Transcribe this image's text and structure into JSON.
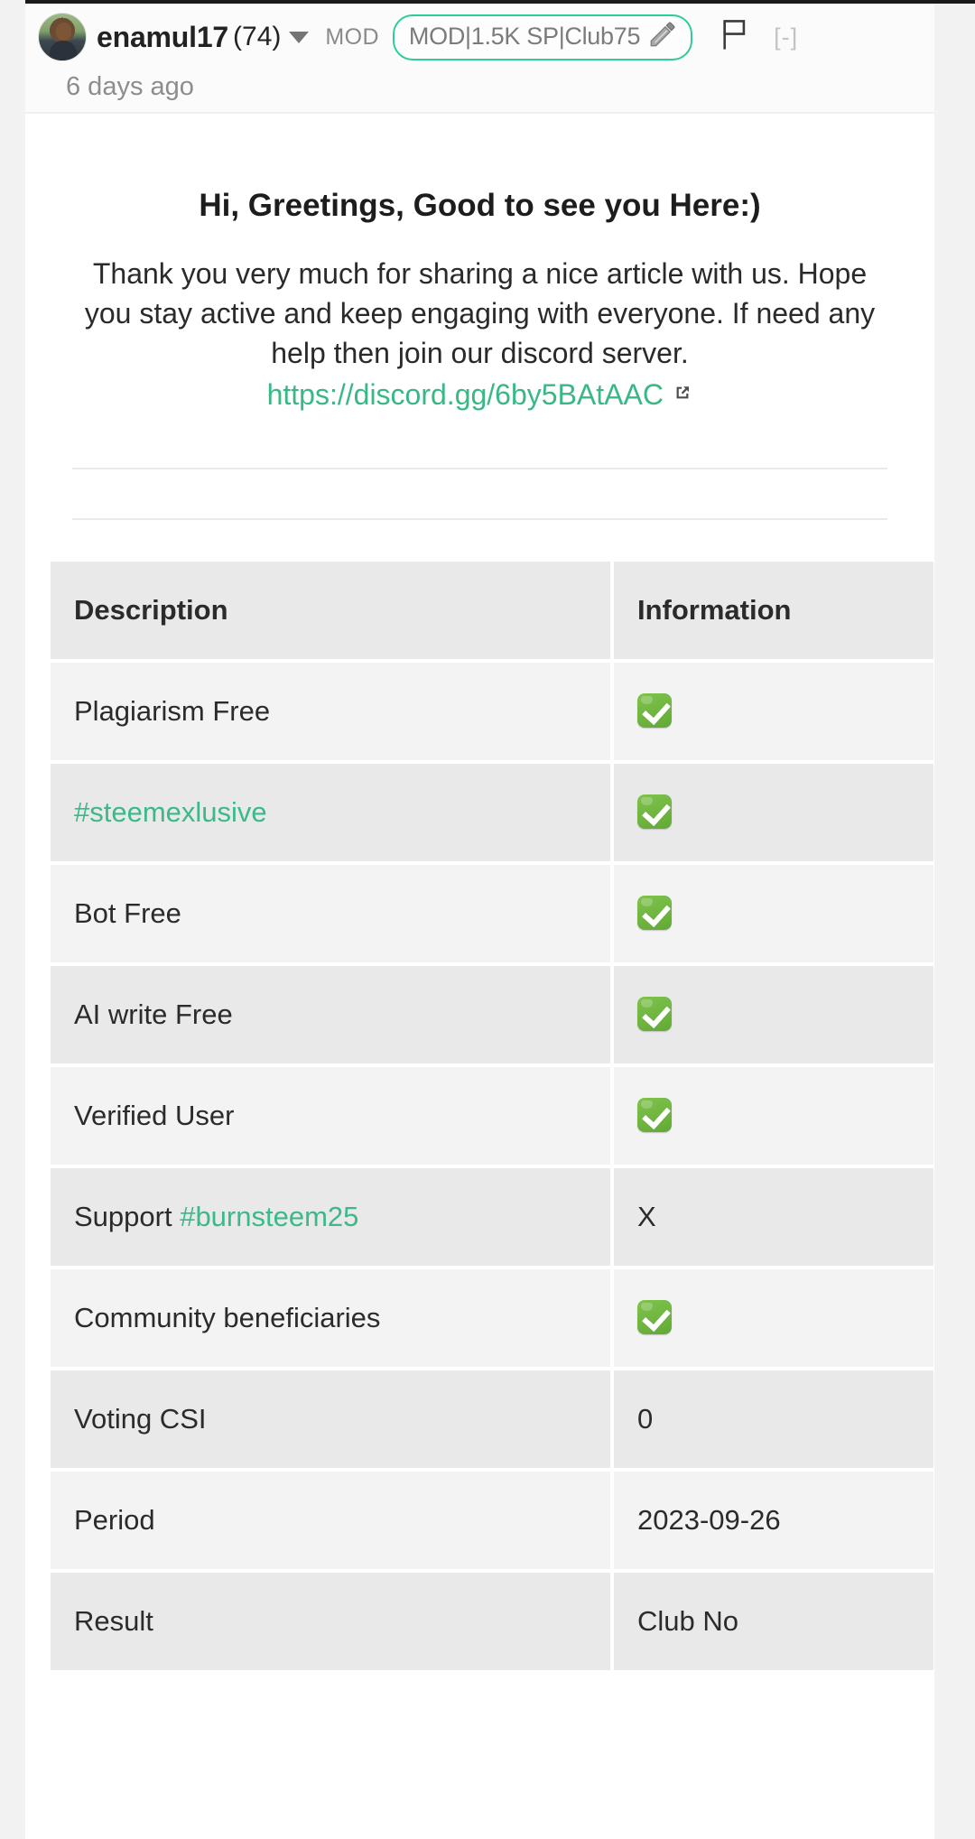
{
  "header": {
    "author": "enamul17",
    "reputation": "(74)",
    "mod_label": "MOD",
    "badge_text": "MOD|1.5K SP|Club75",
    "pencil_icon": "pencil-icon",
    "flag_icon": "flag-icon",
    "collapse_label": "[-]",
    "timestamp": "6 days ago",
    "caret_icon": "chevron-down-icon",
    "avatar_alt": "avatar"
  },
  "body": {
    "greeting": "Hi, Greetings, Good to see you Here:)",
    "paragraph": "Thank you very much for sharing a nice article with us. Hope you stay active and keep engaging with everyone. If need any help then join our discord server.",
    "discord_url": "https://discord.gg/6by5BAtAAC",
    "external_link_icon": "external-link-icon"
  },
  "table": {
    "headers": [
      "Description",
      "Information"
    ],
    "rows": [
      {
        "description": "Plagiarism Free",
        "tag": "",
        "value": "",
        "value_type": "check"
      },
      {
        "description": "",
        "tag": "#steemexlusive",
        "value": "",
        "value_type": "check"
      },
      {
        "description": "Bot Free",
        "tag": "",
        "value": "",
        "value_type": "check"
      },
      {
        "description": "AI write Free",
        "tag": "",
        "value": "",
        "value_type": "check"
      },
      {
        "description": "Verified User",
        "tag": "",
        "value": "",
        "value_type": "check"
      },
      {
        "description": "Support ",
        "tag": "#burnsteem25",
        "value": "X",
        "value_type": "text"
      },
      {
        "description": "Community beneficiaries",
        "tag": "",
        "value": "",
        "value_type": "check"
      },
      {
        "description": "Voting CSI",
        "tag": "",
        "value": "0",
        "value_type": "text"
      },
      {
        "description": "Period",
        "tag": "",
        "value": "2023-09-26",
        "value_type": "text"
      },
      {
        "description": "Result",
        "tag": "",
        "value": "Club No",
        "value_type": "text",
        "bold": true
      }
    ]
  },
  "colors": {
    "accent_green": "#2ecc9b",
    "link_green": "#39b885",
    "tag_green": "#3cb98a",
    "check_green": "#6fb53f",
    "page_bg": "#f2f2f2",
    "card_bg": "#ffffff",
    "row_light": "#f3f3f3",
    "row_dark": "#e9e9e9"
  }
}
